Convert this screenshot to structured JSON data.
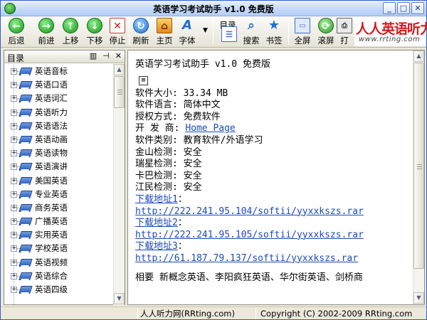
{
  "window": {
    "title": "英语学习考试助手 v1.0 免费版",
    "controls": [
      "_",
      "□",
      "✕"
    ]
  },
  "toolbar": {
    "buttons": [
      {
        "label": "后退",
        "icon": "back-arrow-icon",
        "glyph": "←"
      },
      {
        "label": "前进",
        "icon": "forward-arrow-icon",
        "glyph": "→"
      },
      {
        "label": "上移",
        "icon": "up-arrow-icon",
        "glyph": "↑"
      },
      {
        "label": "下移",
        "icon": "down-arrow-icon",
        "glyph": "↓"
      },
      {
        "label": "停止",
        "icon": "stop-icon",
        "glyph": "✕"
      },
      {
        "label": "刷新",
        "icon": "refresh-icon",
        "glyph": "↻"
      },
      {
        "label": "主页",
        "icon": "home-icon",
        "glyph": "⌂"
      },
      {
        "label": "字体",
        "icon": "font-icon",
        "glyph": "A"
      },
      {
        "label": "目录",
        "icon": "contents-icon",
        "glyph": "☰"
      },
      {
        "label": "搜索",
        "icon": "search-icon",
        "glyph": "⌕"
      },
      {
        "label": "书签",
        "icon": "bookmark-star-icon",
        "glyph": "★"
      },
      {
        "label": "全屏",
        "icon": "fullscreen-icon",
        "glyph": "▭"
      },
      {
        "label": "滚屏",
        "icon": "autoscroll-icon",
        "glyph": "⟳"
      },
      {
        "label": "打",
        "icon": "print-icon",
        "glyph": "⎙"
      }
    ],
    "logo": {
      "text": "人人英语听力",
      "url": "www.rrting.com"
    }
  },
  "sidebar": {
    "title": "目录",
    "header_buttons": [
      "▥",
      "⊣",
      "✕"
    ],
    "items": [
      "英语音标",
      "英语口语",
      "英语词汇",
      "英语听力",
      "英语语法",
      "英语动画",
      "英语读物",
      "英语演讲",
      "美国英语",
      "专业英语",
      "商务英语",
      "广播英语",
      "实用英语",
      "学校英语",
      "英语视频",
      "英语综合",
      "英语四级"
    ]
  },
  "content": {
    "heading": "英语学习考试助手 v1.0 免费版",
    "image_placeholder": "⊠",
    "fields": [
      {
        "key": "软件大小:",
        "value": "33.34 MB"
      },
      {
        "key": "软件语言:",
        "value": "简体中文"
      },
      {
        "key": "授权方式:",
        "value": "免费软件"
      },
      {
        "key": "开 发 商:",
        "value": "Home Page",
        "link": true
      },
      {
        "key": "软件类别:",
        "value": "教育软件/外语学习"
      },
      {
        "key": "金山检测:",
        "value": "安全"
      },
      {
        "key": "瑞星检测:",
        "value": "安全"
      },
      {
        "key": "卡巴检测:",
        "value": "安全"
      },
      {
        "key": "江民检测:",
        "value": "安全"
      }
    ],
    "downloads": [
      {
        "label": "下载地址1",
        "url": "http://222.241.95.104/softii/yyxxkszs.rar"
      },
      {
        "label": "下载地址2",
        "url": "http://222.241.95.105/softii/yyxxkszs.rar"
      },
      {
        "label": "下载地址3",
        "url": "http://61.187.79.137/softii/yyxxkszs.rar"
      }
    ],
    "colon": "：",
    "footnote": "相要 新概念英语、李阳疯狂英语、华尔街英语、剑桥商"
  },
  "statusbar": {
    "left": "人人听力网(RRting.com)",
    "right": "Copyright (C) 2002-2009 RRting.com"
  }
}
